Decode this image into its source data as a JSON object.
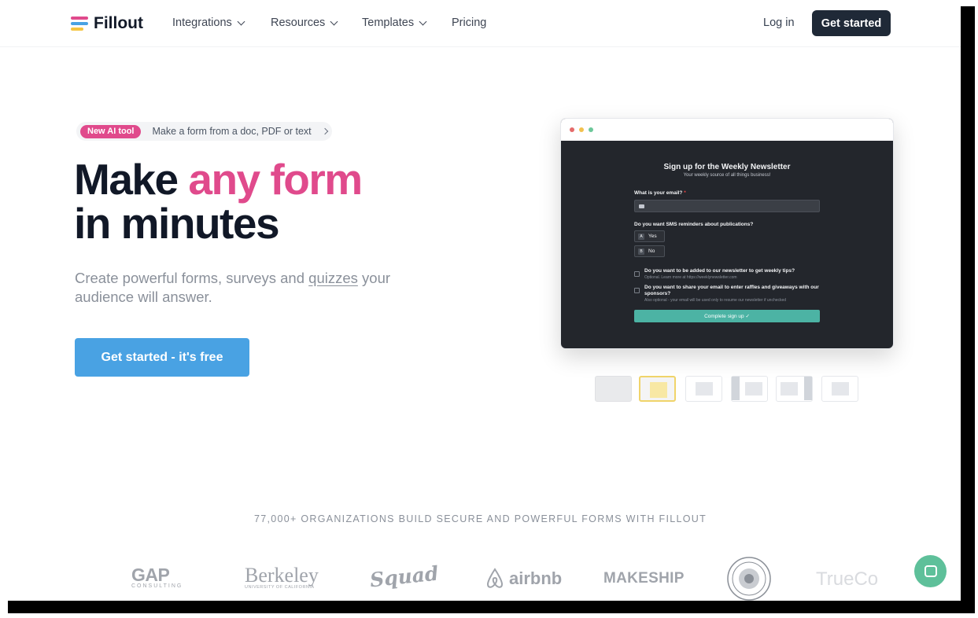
{
  "nav": {
    "brand": "Fillout",
    "items": [
      "Integrations",
      "Resources",
      "Templates",
      "Pricing"
    ],
    "login": "Log in",
    "cta": "Get started"
  },
  "hero": {
    "badge": "New AI tool",
    "badge_text": "Make a form from a doc, PDF or text",
    "title_part1": "Make ",
    "title_accent": "any form",
    "title_line2": "in minutes",
    "subtitle_pre": "Create powerful forms, surveys and ",
    "subtitle_link": "quizzes",
    "subtitle_post": " your audience will answer.",
    "cta": "Get started - it's free"
  },
  "preview_form": {
    "title": "Sign up for the Weekly Newsletter",
    "subtitle": "Your weekly source of all things business!",
    "q1": "What is your email?",
    "q1_required": " *",
    "q2": "Do you want SMS reminders about publications?",
    "opt_a_key": "A",
    "opt_a": "Yes",
    "opt_b_key": "B",
    "opt_b": "No",
    "q3": "Do you want to be added to our newsletter to get weekly tips?",
    "q3_sub": "Optional. Learn more at https://weeklynewsletter.com",
    "q4": "Do you want to share your email to enter raffles and giveaways with our sponsors?",
    "q4_sub": "Also optional - your email will be used only to resume our newsletter if unchecked",
    "submit": "Complete sign up ✓"
  },
  "social_proof": {
    "heading": "77,000+ ORGANIZATIONS BUILD SECURE AND POWERFUL FORMS WITH FILLOUT",
    "logos": [
      "GAP",
      "CONSULTING",
      "Berkeley",
      "UNIVERSITY OF CALIFORNIA",
      "Squad",
      "airbnb",
      "MAKESHIP",
      "TrueCo"
    ]
  },
  "colors": {
    "accent_pink": "#e04a8c",
    "primary_blue": "#49a2e3",
    "dark": "#1f2937",
    "form_button": "#4cb3a4",
    "chat": "#5ec09a"
  }
}
